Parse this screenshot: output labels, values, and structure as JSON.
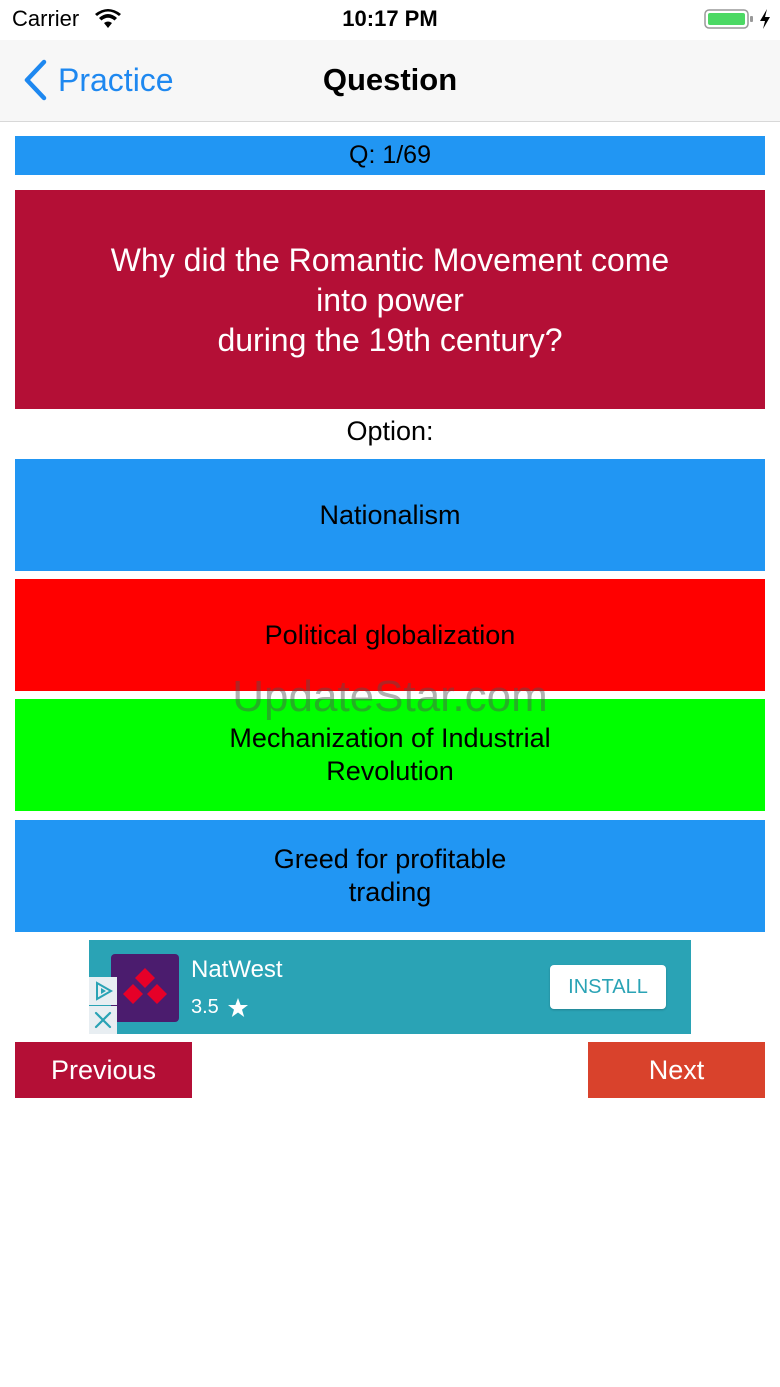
{
  "status_bar": {
    "carrier": "Carrier",
    "time": "10:17 PM",
    "battery_color": "#4cd964"
  },
  "nav": {
    "back_label": "Practice",
    "title": "Question",
    "accent": "#1e88f0"
  },
  "quiz": {
    "counter": "Q: 1/69",
    "question_lines": [
      "Why did the Romantic Movement come",
      "into power",
      "during the 19th century?"
    ],
    "option_heading": "Option:",
    "options": [
      {
        "label": "Nationalism",
        "color": "#2196f3"
      },
      {
        "label": "Political globalization",
        "color": "#ff0000"
      },
      {
        "label": "Mechanization of Industrial Revolution",
        "color": "#00ff00"
      },
      {
        "label": "Greed for profitable trading",
        "color": "#2196f3"
      }
    ],
    "question_color": "#b40f36"
  },
  "watermark": "UpdateStar.com",
  "ad": {
    "advertiser": "NatWest",
    "rating": "3.5",
    "install_label": "INSTALL",
    "background": "#2aa3b5"
  },
  "footer": {
    "previous_label": "Previous",
    "next_label": "Next"
  }
}
